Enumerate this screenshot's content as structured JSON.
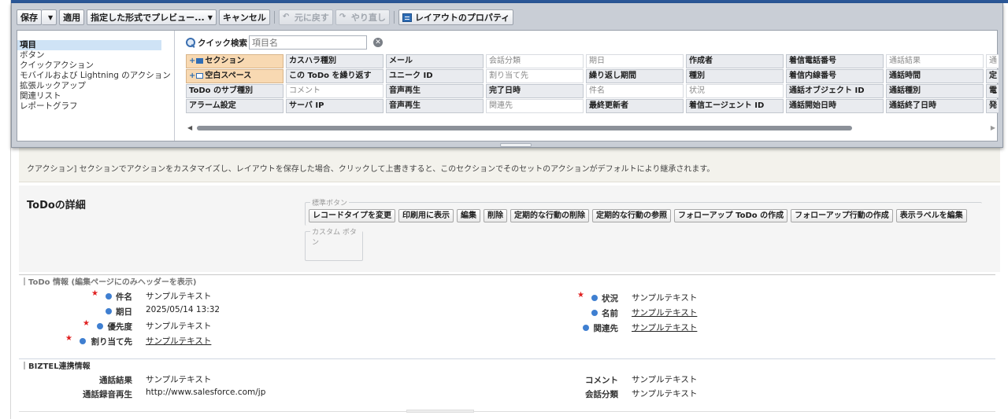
{
  "toolbar": {
    "save": "保存",
    "apply": "適用",
    "preview": "指定した形式でプレビュー...",
    "cancel": "キャンセル",
    "undo": "元に戻す",
    "redo": "やり直し",
    "layout_props": "レイアウトのプロパティ"
  },
  "categories": [
    {
      "label": "項目",
      "active": true
    },
    {
      "label": "ボタン"
    },
    {
      "label": "クイックアクション"
    },
    {
      "label": "モバイルおよび Lightning のアクション"
    },
    {
      "label": "拡張ルックアップ"
    },
    {
      "label": "関連リスト"
    },
    {
      "label": "レポートグラフ"
    }
  ],
  "quick_search": {
    "label": "クイック検索",
    "placeholder": "項目名"
  },
  "palette_rows": [
    [
      "セクション",
      "カスハラ種別",
      "メール",
      "会話分類",
      "期日",
      "作成者",
      "着信電話番号",
      "通話結果",
      "通"
    ],
    [
      "空白スペース",
      "この ToDo を繰り返す",
      "ユニーク ID",
      "割り当て先",
      "繰り返し期間",
      "種別",
      "着信内線番号",
      "通話時間",
      "定"
    ],
    [
      "ToDo のサブ種別",
      "コメント",
      "音声再生",
      "完了日時",
      "件名",
      "状況",
      "通話オブジェクト ID",
      "通話種別",
      "電"
    ],
    [
      "アラーム設定",
      "サーバ IP",
      "音声再生",
      "関連先",
      "最終更新者",
      "着信エージェント ID",
      "通話開始日時",
      "通話終了日時",
      "発"
    ]
  ],
  "palette_dim": [
    [
      false,
      false,
      false,
      true,
      true,
      false,
      false,
      true,
      true
    ],
    [
      false,
      false,
      false,
      true,
      false,
      false,
      false,
      false,
      false
    ],
    [
      false,
      true,
      false,
      false,
      true,
      true,
      false,
      false,
      false
    ],
    [
      false,
      false,
      false,
      true,
      false,
      false,
      false,
      false,
      false
    ]
  ],
  "info": {
    "text": "クアクション] セクションでアクションをカスタマイズし、レイアウトを保存した場合、クリックして上書きすると、このセクションでそのセットのアクションがデフォルトにより継承されます。"
  },
  "detail": {
    "title": "ToDoの詳細",
    "standard_legend": "標準ボタン",
    "custom_legend": "カスタム ボタン",
    "standard_buttons": [
      "レコードタイプを変更",
      "印刷用に表示",
      "編集",
      "削除",
      "定期的な行動の削除",
      "定期的な行動の参照",
      "フォローアップ ToDo の作成",
      "フォローアップ行動の作成",
      "表示ラベルを編集"
    ]
  },
  "todo_section": {
    "title": "ToDo 情報 (編集ページにのみヘッダーを表示)",
    "left": [
      {
        "label": "件名",
        "value": "サンプルテキスト",
        "required": true,
        "link": false
      },
      {
        "label": "期日",
        "value": "2025/05/14 13:32",
        "required": false,
        "link": false
      },
      {
        "label": "優先度",
        "value": "サンプルテキスト",
        "required": true,
        "link": false
      },
      {
        "label": "割り当て先",
        "value": "サンプルテキスト",
        "required": true,
        "link": true
      }
    ],
    "right": [
      {
        "label": "状況",
        "value": "サンプルテキスト",
        "required": true,
        "link": false
      },
      {
        "label": "名前",
        "value": "サンプルテキスト",
        "required": false,
        "link": true
      },
      {
        "label": "関連先",
        "value": "サンプルテキスト",
        "required": false,
        "link": true
      }
    ]
  },
  "biztel_section": {
    "title": "BIZTEL連携情報",
    "left": [
      {
        "label": "通話結果",
        "value": "サンプルテキスト"
      },
      {
        "label": "通話録音再生",
        "value": "http://www.salesforce.com/jp"
      }
    ],
    "right": [
      {
        "label": "コメント",
        "value": "サンプルテキスト"
      },
      {
        "label": "会話分類",
        "value": "サンプルテキスト"
      }
    ]
  },
  "colors": {
    "accent": "#3f7fd1",
    "required": "#e02020",
    "highlight": "#f8d9b2"
  }
}
